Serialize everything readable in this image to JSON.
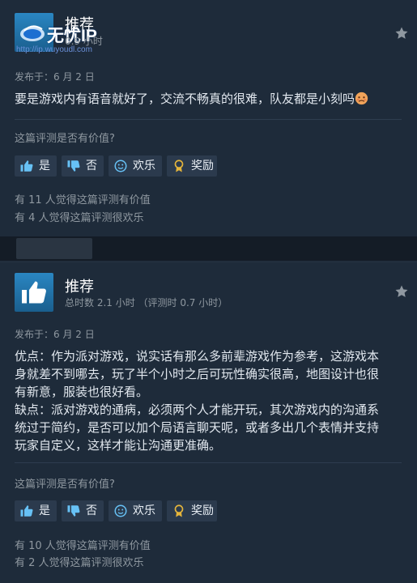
{
  "watermark": {
    "brand": "无忧IP",
    "url": "http://ip.wuyoudl.com"
  },
  "reviews": [
    {
      "verdict": "推荐",
      "hours": "0.9 小时",
      "posted": "发布于：6 月 2 日",
      "body": [
        "要是游戏内有语音就好了，交流不畅真的很难，队友都是小刻吗"
      ],
      "helpful_question": "这篇评测是否有价值?",
      "buttons": {
        "yes": "是",
        "no": "否",
        "funny": "欢乐",
        "award": "奖励"
      },
      "stats": [
        "有 11 人觉得这篇评测有价值",
        "有 4 人觉得这篇评测很欢乐"
      ]
    },
    {
      "verdict": "推荐",
      "hours": "总时数 2.1 小时 （评测时 0.7 小时）",
      "posted": "发布于：6 月 2 日",
      "body": [
        "优点：作为派对游戏，说实话有那么多前辈游戏作为参考，这游戏本",
        "身就差不到哪去，玩了半个小时之后可玩性确实很高，地图设计也很",
        "有新意，服装也很好看。",
        "缺点：派对游戏的通病，必须两个人才能开玩，其次游戏内的沟通系",
        "统过于简约，是否可以加个局语言聊天呢，或者多出几个表情并支持",
        "玩家自定义，这样才能让沟通更准确。"
      ],
      "helpful_question": "这篇评测是否有价值?",
      "buttons": {
        "yes": "是",
        "no": "否",
        "funny": "欢乐",
        "award": "奖励"
      },
      "stats": [
        "有 10 人觉得这篇评测有价值",
        "有 2 人觉得这篇评测很欢乐"
      ]
    }
  ],
  "colors": {
    "background": "#1b2838",
    "card": "#1e2b3a",
    "button": "#2b3a4d",
    "accent_blue": "#2a86c2",
    "award": "#e5b53b"
  },
  "icons": [
    "thumbs-up-icon",
    "thumbs-down-icon",
    "smiley-icon",
    "award-ribbon-icon",
    "star-icon",
    "sad-emoji-icon"
  ]
}
